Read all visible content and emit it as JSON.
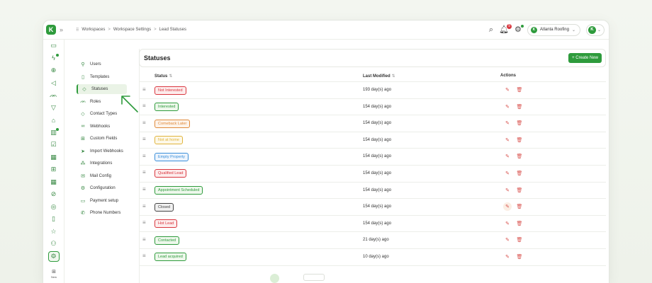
{
  "app": {
    "logo_letter": "K"
  },
  "breadcrumb": {
    "items": [
      "Workspaces",
      "Workspace Settings",
      "Lead Statuses"
    ],
    "separator": ">"
  },
  "topbar": {
    "notifications_count": "9",
    "workspace_name": "Atlanta Roofing",
    "workspace_avatar": "K",
    "user_avatar": "K"
  },
  "rail": {
    "icons": [
      "folder-icon",
      "bolt-icon",
      "globe-icon",
      "megaphone-icon",
      "users-icon",
      "filter-icon",
      "building-icon",
      "chart-icon",
      "checklist-icon",
      "calendar-icon",
      "grid-icon",
      "calendar-icon",
      "compass-icon",
      "target-icon",
      "document-icon",
      "star-icon",
      "user-plus-icon",
      "settings-icon"
    ],
    "new_label": "New"
  },
  "settings_nav": {
    "items": [
      {
        "label": "Users",
        "icon": "user-icon"
      },
      {
        "label": "Templates",
        "icon": "document-icon"
      },
      {
        "label": "Statuses",
        "icon": "tag-icon"
      },
      {
        "label": "Roles",
        "icon": "users-icon"
      },
      {
        "label": "Contact Types",
        "icon": "tag-icon"
      },
      {
        "label": "Webhooks",
        "icon": "link-icon"
      },
      {
        "label": "Custom Fields",
        "icon": "table-icon"
      },
      {
        "label": "Import Webhooks",
        "icon": "send-icon"
      },
      {
        "label": "Integrations",
        "icon": "integration-icon"
      },
      {
        "label": "Mail Config",
        "icon": "mail-icon"
      },
      {
        "label": "Configuration",
        "icon": "gear-icon"
      },
      {
        "label": "Payment setup",
        "icon": "card-icon"
      },
      {
        "label": "Phone Numbers",
        "icon": "phone-icon"
      }
    ],
    "active_index": 2
  },
  "content": {
    "title": "Statuses",
    "create_button": "+ Create New",
    "columns": {
      "status": "Status",
      "modified": "Last Modified",
      "actions": "Actions"
    },
    "rows": [
      {
        "status": "Not Interested",
        "modified": "193 day(s) ago",
        "color": "#d9363e",
        "bg": "#fdecec"
      },
      {
        "status": "Interested",
        "modified": "154 day(s) ago",
        "color": "#2e9b3c",
        "bg": "#eef8ec"
      },
      {
        "status": "Comeback Later",
        "modified": "154 day(s) ago",
        "color": "#e08a3c",
        "bg": "#fdf3ea"
      },
      {
        "status": "Not at home",
        "modified": "154 day(s) ago",
        "color": "#e0b43c",
        "bg": "#fdf8e8"
      },
      {
        "status": "Empty Property",
        "modified": "154 day(s) ago",
        "color": "#3b8fd9",
        "bg": "#ecf4fd"
      },
      {
        "status": "Qualified Lead",
        "modified": "154 day(s) ago",
        "color": "#d9363e",
        "bg": "#fdecec"
      },
      {
        "status": "Appointment Scheduled",
        "modified": "154 day(s) ago",
        "color": "#2e9b3c",
        "bg": "#eef8ec"
      },
      {
        "status": "Closed",
        "modified": "154 day(s) ago",
        "color": "#444444",
        "bg": "#f0f0f0"
      },
      {
        "status": "Hot Lead",
        "modified": "154 day(s) ago",
        "color": "#d9363e",
        "bg": "#fdecec"
      },
      {
        "status": "Contacted",
        "modified": "21 day(s) ago",
        "color": "#2e9b3c",
        "bg": "#eef8ec"
      },
      {
        "status": "Lead acquired",
        "modified": "10 day(s) ago",
        "color": "#2e9b3c",
        "bg": "#eef8ec"
      }
    ],
    "hover_row_index": 7
  },
  "colors": {
    "accent": "#2e9b3c",
    "danger": "#d9534f"
  }
}
